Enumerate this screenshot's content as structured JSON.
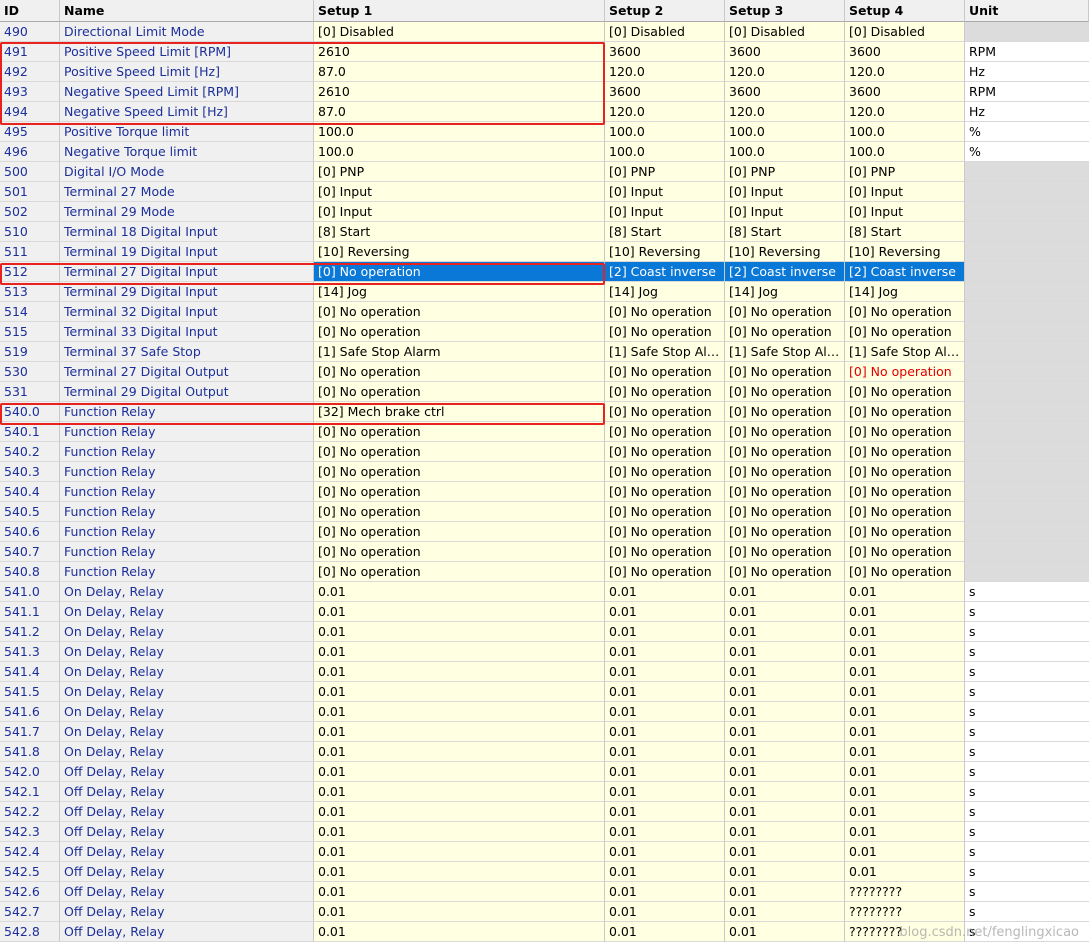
{
  "headers": {
    "id": "ID",
    "name": "Name",
    "setup1": "Setup 1",
    "setup2": "Setup 2",
    "setup3": "Setup 3",
    "setup4": "Setup 4",
    "unit": "Unit"
  },
  "rows": [
    {
      "id": "490",
      "name": "Directional Limit Mode",
      "s1": "[0] Disabled",
      "s2": "[0] Disabled",
      "s3": "[0] Disabled",
      "s4": "[0] Disabled",
      "unit": ""
    },
    {
      "id": "491",
      "name": "Positive Speed Limit [RPM]",
      "s1": "2610",
      "s2": "3600",
      "s3": "3600",
      "s4": "3600",
      "unit": "RPM"
    },
    {
      "id": "492",
      "name": "Positive Speed Limit [Hz]",
      "s1": "87.0",
      "s2": "120.0",
      "s3": "120.0",
      "s4": "120.0",
      "unit": "Hz"
    },
    {
      "id": "493",
      "name": "Negative Speed Limit [RPM]",
      "s1": "2610",
      "s2": "3600",
      "s3": "3600",
      "s4": "3600",
      "unit": "RPM"
    },
    {
      "id": "494",
      "name": "Negative Speed Limit [Hz]",
      "s1": "87.0",
      "s2": "120.0",
      "s3": "120.0",
      "s4": "120.0",
      "unit": "Hz"
    },
    {
      "id": "495",
      "name": "Positive Torque limit",
      "s1": "100.0",
      "s2": "100.0",
      "s3": "100.0",
      "s4": "100.0",
      "unit": "%"
    },
    {
      "id": "496",
      "name": "Negative Torque limit",
      "s1": "100.0",
      "s2": "100.0",
      "s3": "100.0",
      "s4": "100.0",
      "unit": "%"
    },
    {
      "id": "500",
      "name": "Digital I/O Mode",
      "s1": "[0] PNP",
      "s2": "[0] PNP",
      "s3": "[0] PNP",
      "s4": "[0] PNP",
      "unit": ""
    },
    {
      "id": "501",
      "name": "Terminal 27 Mode",
      "s1": "[0] Input",
      "s2": "[0] Input",
      "s3": "[0] Input",
      "s4": "[0] Input",
      "unit": ""
    },
    {
      "id": "502",
      "name": "Terminal 29 Mode",
      "s1": "[0] Input",
      "s2": "[0] Input",
      "s3": "[0] Input",
      "s4": "[0] Input",
      "unit": ""
    },
    {
      "id": "510",
      "name": "Terminal 18 Digital Input",
      "s1": "[8] Start",
      "s2": "[8] Start",
      "s3": "[8] Start",
      "s4": "[8] Start",
      "unit": ""
    },
    {
      "id": "511",
      "name": "Terminal 19 Digital Input",
      "s1": "[10] Reversing",
      "s2": "[10] Reversing",
      "s3": "[10] Reversing",
      "s4": "[10] Reversing",
      "unit": ""
    },
    {
      "id": "512",
      "name": "Terminal 27 Digital Input",
      "s1": "[0] No operation",
      "s2": "[2] Coast inverse",
      "s3": "[2] Coast inverse",
      "s4": "[2] Coast inverse",
      "unit": "",
      "selected": true
    },
    {
      "id": "513",
      "name": "Terminal 29 Digital Input",
      "s1": "[14] Jog",
      "s2": "[14] Jog",
      "s3": "[14] Jog",
      "s4": "[14] Jog",
      "unit": ""
    },
    {
      "id": "514",
      "name": "Terminal 32 Digital Input",
      "s1": "[0] No operation",
      "s2": "[0] No operation",
      "s3": "[0] No operation",
      "s4": "[0] No operation",
      "unit": ""
    },
    {
      "id": "515",
      "name": "Terminal 33 Digital Input",
      "s1": "[0] No operation",
      "s2": "[0] No operation",
      "s3": "[0] No operation",
      "s4": "[0] No operation",
      "unit": ""
    },
    {
      "id": "519",
      "name": "Terminal 37 Safe Stop",
      "s1": "[1] Safe Stop Alarm",
      "s2": "[1] Safe Stop Alar...",
      "s3": "[1] Safe Stop Alar...",
      "s4": "[1] Safe Stop Alar...",
      "unit": ""
    },
    {
      "id": "530",
      "name": "Terminal 27 Digital Output",
      "s1": "[0] No operation",
      "s2": "[0] No operation",
      "s3": "[0] No operation",
      "s4": "[0] No operation",
      "unit": "",
      "s4err": true
    },
    {
      "id": "531",
      "name": "Terminal 29 Digital Output",
      "s1": "[0] No operation",
      "s2": "[0] No operation",
      "s3": "[0] No operation",
      "s4": "[0] No operation",
      "unit": ""
    },
    {
      "id": "540.0",
      "name": "Function Relay",
      "s1": "[32] Mech brake ctrl",
      "s2": "[0] No operation",
      "s3": "[0] No operation",
      "s4": "[0] No operation",
      "unit": ""
    },
    {
      "id": "540.1",
      "name": "Function Relay",
      "s1": "[0] No operation",
      "s2": "[0] No operation",
      "s3": "[0] No operation",
      "s4": "[0] No operation",
      "unit": ""
    },
    {
      "id": "540.2",
      "name": "Function Relay",
      "s1": "[0] No operation",
      "s2": "[0] No operation",
      "s3": "[0] No operation",
      "s4": "[0] No operation",
      "unit": ""
    },
    {
      "id": "540.3",
      "name": "Function Relay",
      "s1": "[0] No operation",
      "s2": "[0] No operation",
      "s3": "[0] No operation",
      "s4": "[0] No operation",
      "unit": ""
    },
    {
      "id": "540.4",
      "name": "Function Relay",
      "s1": "[0] No operation",
      "s2": "[0] No operation",
      "s3": "[0] No operation",
      "s4": "[0] No operation",
      "unit": ""
    },
    {
      "id": "540.5",
      "name": "Function Relay",
      "s1": "[0] No operation",
      "s2": "[0] No operation",
      "s3": "[0] No operation",
      "s4": "[0] No operation",
      "unit": ""
    },
    {
      "id": "540.6",
      "name": "Function Relay",
      "s1": "[0] No operation",
      "s2": "[0] No operation",
      "s3": "[0] No operation",
      "s4": "[0] No operation",
      "unit": ""
    },
    {
      "id": "540.7",
      "name": "Function Relay",
      "s1": "[0] No operation",
      "s2": "[0] No operation",
      "s3": "[0] No operation",
      "s4": "[0] No operation",
      "unit": ""
    },
    {
      "id": "540.8",
      "name": "Function Relay",
      "s1": "[0] No operation",
      "s2": "[0] No operation",
      "s3": "[0] No operation",
      "s4": "[0] No operation",
      "unit": ""
    },
    {
      "id": "541.0",
      "name": "On Delay, Relay",
      "s1": "0.01",
      "s2": "0.01",
      "s3": "0.01",
      "s4": "0.01",
      "unit": "s"
    },
    {
      "id": "541.1",
      "name": "On Delay, Relay",
      "s1": "0.01",
      "s2": "0.01",
      "s3": "0.01",
      "s4": "0.01",
      "unit": "s"
    },
    {
      "id": "541.2",
      "name": "On Delay, Relay",
      "s1": "0.01",
      "s2": "0.01",
      "s3": "0.01",
      "s4": "0.01",
      "unit": "s"
    },
    {
      "id": "541.3",
      "name": "On Delay, Relay",
      "s1": "0.01",
      "s2": "0.01",
      "s3": "0.01",
      "s4": "0.01",
      "unit": "s"
    },
    {
      "id": "541.4",
      "name": "On Delay, Relay",
      "s1": "0.01",
      "s2": "0.01",
      "s3": "0.01",
      "s4": "0.01",
      "unit": "s"
    },
    {
      "id": "541.5",
      "name": "On Delay, Relay",
      "s1": "0.01",
      "s2": "0.01",
      "s3": "0.01",
      "s4": "0.01",
      "unit": "s"
    },
    {
      "id": "541.6",
      "name": "On Delay, Relay",
      "s1": "0.01",
      "s2": "0.01",
      "s3": "0.01",
      "s4": "0.01",
      "unit": "s"
    },
    {
      "id": "541.7",
      "name": "On Delay, Relay",
      "s1": "0.01",
      "s2": "0.01",
      "s3": "0.01",
      "s4": "0.01",
      "unit": "s"
    },
    {
      "id": "541.8",
      "name": "On Delay, Relay",
      "s1": "0.01",
      "s2": "0.01",
      "s3": "0.01",
      "s4": "0.01",
      "unit": "s"
    },
    {
      "id": "542.0",
      "name": "Off Delay, Relay",
      "s1": "0.01",
      "s2": "0.01",
      "s3": "0.01",
      "s4": "0.01",
      "unit": "s"
    },
    {
      "id": "542.1",
      "name": "Off Delay, Relay",
      "s1": "0.01",
      "s2": "0.01",
      "s3": "0.01",
      "s4": "0.01",
      "unit": "s"
    },
    {
      "id": "542.2",
      "name": "Off Delay, Relay",
      "s1": "0.01",
      "s2": "0.01",
      "s3": "0.01",
      "s4": "0.01",
      "unit": "s"
    },
    {
      "id": "542.3",
      "name": "Off Delay, Relay",
      "s1": "0.01",
      "s2": "0.01",
      "s3": "0.01",
      "s4": "0.01",
      "unit": "s"
    },
    {
      "id": "542.4",
      "name": "Off Delay, Relay",
      "s1": "0.01",
      "s2": "0.01",
      "s3": "0.01",
      "s4": "0.01",
      "unit": "s"
    },
    {
      "id": "542.5",
      "name": "Off Delay, Relay",
      "s1": "0.01",
      "s2": "0.01",
      "s3": "0.01",
      "s4": "0.01",
      "unit": "s"
    },
    {
      "id": "542.6",
      "name": "Off Delay, Relay",
      "s1": "0.01",
      "s2": "0.01",
      "s3": "0.01",
      "s4": "????????",
      "unit": "s"
    },
    {
      "id": "542.7",
      "name": "Off Delay, Relay",
      "s1": "0.01",
      "s2": "0.01",
      "s3": "0.01",
      "s4": "????????",
      "unit": "s"
    },
    {
      "id": "542.8",
      "name": "Off Delay, Relay",
      "s1": "0.01",
      "s2": "0.01",
      "s3": "0.01",
      "s4": "????????",
      "unit": "s"
    }
  ],
  "watermark": "blog.csdn.net/fenglingxicao",
  "colors": {
    "highlight_border": "#e8231f",
    "selection": "#0a78d7",
    "value_cell_bg": "#ffffe1",
    "id_text": "#1c2f99",
    "error_text": "#e00000"
  }
}
